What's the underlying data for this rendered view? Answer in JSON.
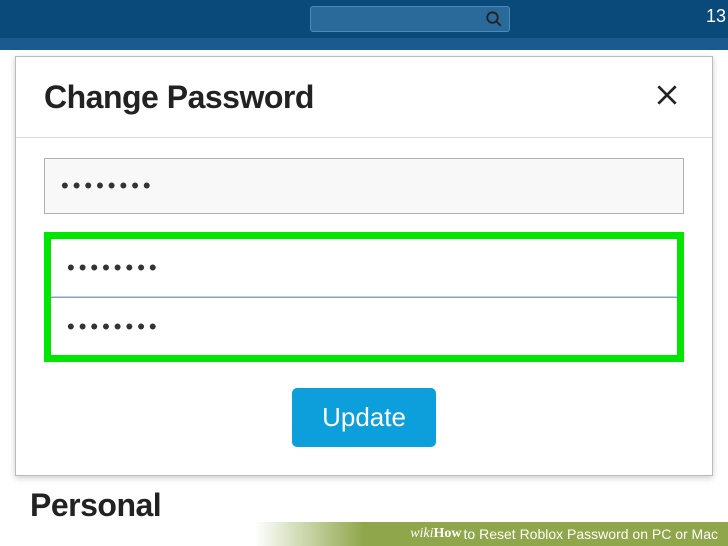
{
  "topbar": {
    "corner_text": "13"
  },
  "dialog": {
    "title": "Change Password",
    "current_password": "••••••••",
    "new_password": "••••••••",
    "confirm_password": "••••••••",
    "update_label": "Update"
  },
  "page": {
    "background_heading": "Personal"
  },
  "caption": {
    "brand_prefix": "wiki",
    "brand_suffix": "How",
    "text": " to Reset Roblox Password on PC or Mac"
  }
}
